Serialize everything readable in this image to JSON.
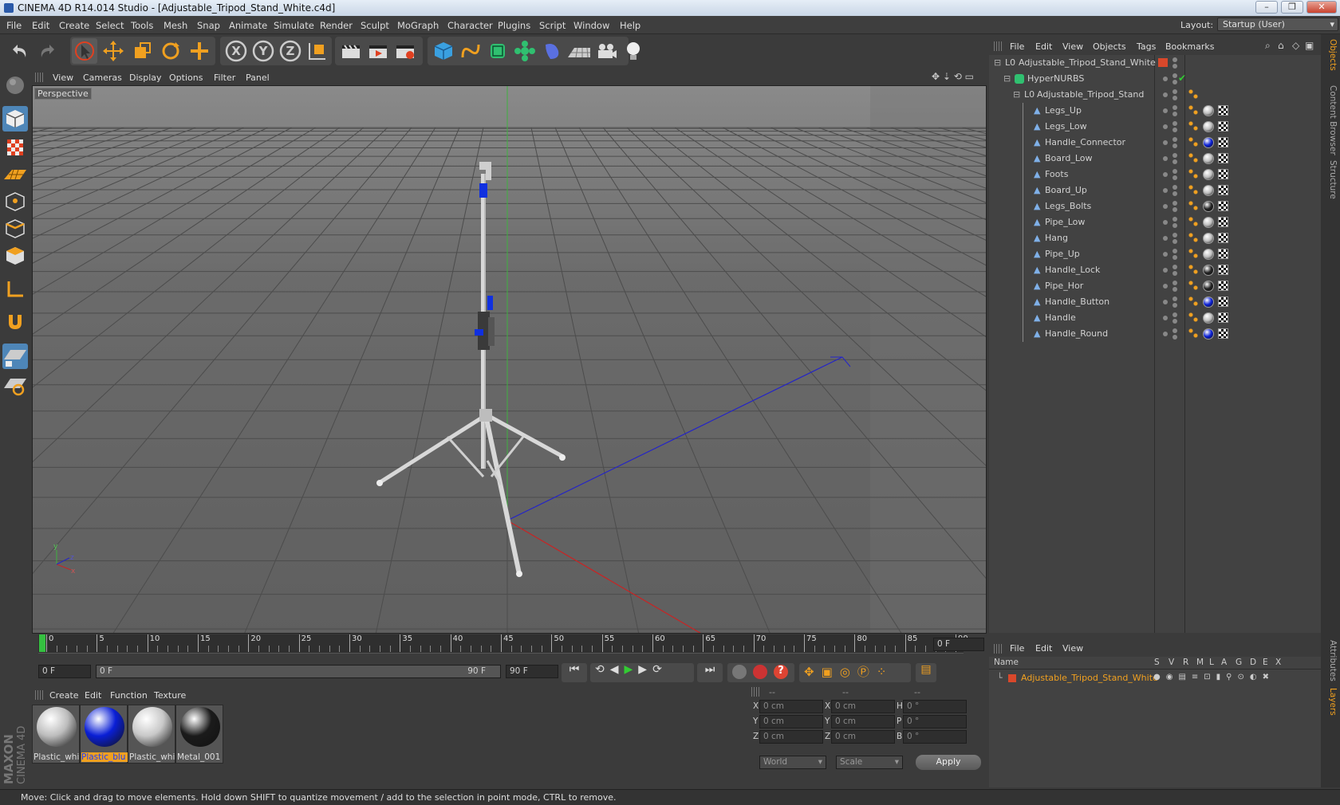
{
  "window": {
    "title": "CINEMA 4D R14.014 Studio - [Adjustable_Tripod_Stand_White.c4d]",
    "buttons": [
      "–",
      "❐",
      "✕"
    ]
  },
  "menu": [
    "File",
    "Edit",
    "Create",
    "Select",
    "Tools",
    "Mesh",
    "Snap",
    "Animate",
    "Simulate",
    "Render",
    "Sculpt",
    "MoGraph",
    "Character",
    "Plugins",
    "Script",
    "Window",
    "Help"
  ],
  "layout": {
    "label": "Layout:",
    "value": "Startup (User)"
  },
  "toolbar": {
    "icons": [
      "undo-icon",
      "redo-icon",
      "select-arrow-icon",
      "move-icon",
      "scale-icon",
      "rotate-icon",
      "add-icon",
      "x-axis-icon",
      "y-axis-icon",
      "z-axis-icon",
      "coordinate-system-icon",
      "render-view-icon",
      "render-picture-viewer-icon",
      "render-settings-icon",
      "cube-primitive-icon",
      "spline-icon",
      "nurbs-icon",
      "array-icon",
      "deformer-icon",
      "floor-icon",
      "camera-icon",
      "light-icon"
    ],
    "axes": [
      "X",
      "Y",
      "Z"
    ]
  },
  "viewport": {
    "menu": [
      "View",
      "Cameras",
      "Display",
      "Options",
      "Filter",
      "Panel"
    ],
    "label": "Perspective",
    "axis_labels": {
      "x": "x",
      "y": "y",
      "z": "z"
    }
  },
  "timeline": {
    "ticks": [
      "0",
      "5",
      "10",
      "15",
      "20",
      "25",
      "30",
      "35",
      "40",
      "45",
      "50",
      "55",
      "60",
      "65",
      "70",
      "75",
      "80",
      "85",
      "90"
    ],
    "frame_field": "0 F"
  },
  "playbar": {
    "start": "0 F",
    "range_start": "0 F",
    "range_end": "90 F",
    "end": "90 F"
  },
  "materials": {
    "menu": [
      "Create",
      "Edit",
      "Function",
      "Texture"
    ],
    "items": [
      {
        "name": "Plastic_whi",
        "color": "#bdbdbd",
        "selected": false
      },
      {
        "name": "Plastic_blu",
        "color": "#0a1fd6",
        "selected": true
      },
      {
        "name": "Plastic_whi",
        "color": "#c8c8c8",
        "selected": false
      },
      {
        "name": "Metal_001",
        "color": "#1b1b1b",
        "selected": false
      }
    ]
  },
  "coords": {
    "headers": [
      "--",
      "--",
      "--"
    ],
    "rows": [
      {
        "a": "X",
        "av": "0 cm",
        "b": "X",
        "bv": "0 cm",
        "c": "H",
        "cv": "0 °"
      },
      {
        "a": "Y",
        "av": "0 cm",
        "b": "Y",
        "bv": "0 cm",
        "c": "P",
        "cv": "0 °"
      },
      {
        "a": "Z",
        "av": "0 cm",
        "b": "Z",
        "bv": "0 cm",
        "c": "B",
        "cv": "0 °"
      }
    ],
    "mode1": "World",
    "mode2": "Scale",
    "apply": "Apply"
  },
  "objects": {
    "menu": [
      "File",
      "Edit",
      "View",
      "Objects",
      "Tags",
      "Bookmarks"
    ],
    "root": "Adjustable_Tripod_Stand_White",
    "hypernurbs": "HyperNURBS",
    "group": "Adjustable_Tripod_Stand",
    "items": [
      {
        "name": "Legs_Up",
        "mat": "#c0c0c0"
      },
      {
        "name": "Legs_Low",
        "mat": "#c0c0c0"
      },
      {
        "name": "Handle_Connector",
        "mat": "#0a1fd6"
      },
      {
        "name": "Board_Low",
        "mat": "#c0c0c0"
      },
      {
        "name": "Foots",
        "mat": "#c0c0c0"
      },
      {
        "name": "Board_Up",
        "mat": "#c0c0c0"
      },
      {
        "name": "Legs_Bolts",
        "mat": "#222222"
      },
      {
        "name": "Pipe_Low",
        "mat": "#c0c0c0"
      },
      {
        "name": "Hang",
        "mat": "#c0c0c0"
      },
      {
        "name": "Pipe_Up",
        "mat": "#c0c0c0"
      },
      {
        "name": "Handle_Lock",
        "mat": "#222222"
      },
      {
        "name": "Pipe_Hor",
        "mat": "#222222"
      },
      {
        "name": "Handle_Button",
        "mat": "#0a1fd6"
      },
      {
        "name": "Handle",
        "mat": "#c0c0c0"
      },
      {
        "name": "Handle_Round",
        "mat": "#0a1fd6"
      }
    ]
  },
  "layers": {
    "menu": [
      "File",
      "Edit",
      "View"
    ],
    "columns": [
      "Name",
      "S",
      "V",
      "R",
      "M",
      "L",
      "A",
      "G",
      "D",
      "E",
      "X"
    ],
    "row": "Adjustable_Tripod_Stand_White"
  },
  "sidetabs": [
    "Objects",
    "Content Browser",
    "Structure",
    "Attributes",
    "Layers"
  ],
  "brand": {
    "line1": "MAXON",
    "line2": "CINEMA 4D"
  },
  "status": "Move: Click and drag to move elements. Hold down SHIFT to quantize movement / add to the selection in point mode, CTRL to remove."
}
